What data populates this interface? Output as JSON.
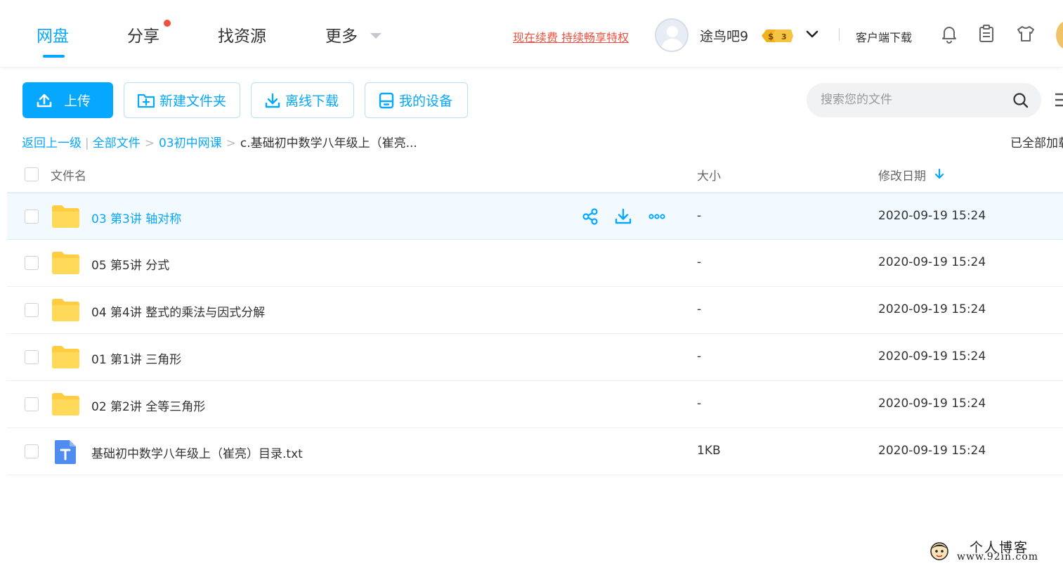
{
  "header": {
    "tabs": [
      {
        "label": "网盘"
      },
      {
        "label": "分享"
      },
      {
        "label": "找资源"
      },
      {
        "label": "更多"
      }
    ],
    "renew_link": "现在续费 持续畅享特权",
    "username": "途鸟吧9",
    "vip_level": "3",
    "client_download": "客户端下载"
  },
  "toolbar": {
    "upload": "上传",
    "new_folder": "新建文件夹",
    "offline_download": "离线下载",
    "my_devices": "我的设备",
    "search_placeholder": "搜索您的文件"
  },
  "breadcrumb": {
    "back": "返回上一级",
    "all_files": "全部文件",
    "folder": "03初中网课",
    "current": "c.基础初中数学八年级上（崔亮..."
  },
  "loaded_status": "已全部加载",
  "table": {
    "col_name": "文件名",
    "col_size": "大小",
    "col_date": "修改日期",
    "rows": [
      {
        "name": "03 第3讲 轴对称",
        "size": "-",
        "date": "2020-09-19 15:24"
      },
      {
        "name": "05 第5讲 分式",
        "size": "-",
        "date": "2020-09-19 15:24"
      },
      {
        "name": "04 第4讲 整式的乘法与因式分解",
        "size": "-",
        "date": "2020-09-19 15:24"
      },
      {
        "name": "01 第1讲 三角形",
        "size": "-",
        "date": "2020-09-19 15:24"
      },
      {
        "name": "02 第2讲 全等三角形",
        "size": "-",
        "date": "2020-09-19 15:24"
      },
      {
        "name": "基础初中数学八年级上（崔亮）目录.txt",
        "size": "1KB",
        "date": "2020-09-19 15:24"
      }
    ]
  },
  "watermark": {
    "title": "个人博客",
    "url": "www.92in.com"
  },
  "colors": {
    "accent": "#06a7ff",
    "folder": "#ffd24d",
    "alert": "#f0503e"
  }
}
